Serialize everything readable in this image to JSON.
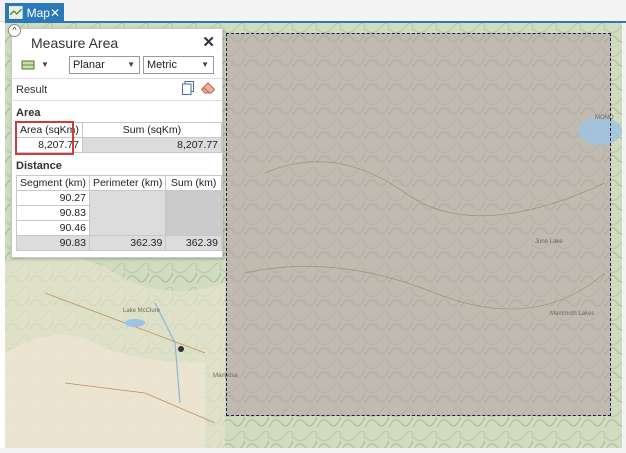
{
  "tab": {
    "label": "Map",
    "close": "✕"
  },
  "panel": {
    "title": "Measure Area",
    "close": "✕",
    "collapse": "^",
    "mode": "Planar",
    "units": "Metric",
    "result_label": "Result",
    "area_section": "Area",
    "distance_section": "Distance",
    "area_table": {
      "headers": [
        "Area (sqKm)",
        "Sum (sqKm)"
      ],
      "values": [
        "8,207.77",
        "8,207.77"
      ]
    },
    "distance_table": {
      "headers": [
        "Segment (km)",
        "Perimeter (km)",
        "Sum (km)"
      ],
      "segments": [
        "90.27",
        "90.83",
        "90.46",
        "90.83"
      ],
      "perimeter": "362.39",
      "sum": "362.39"
    }
  },
  "map_labels": {
    "mariposa": "Mariposa",
    "mammoth": "Mammoth Lakes",
    "june": "June Lake",
    "lake": "Lake McClure",
    "mono": "MONO"
  },
  "colors": {
    "tab_blue": "#2a7ab9",
    "highlight_red": "#d13a3a",
    "selection_overlay": "#b79ea5"
  }
}
